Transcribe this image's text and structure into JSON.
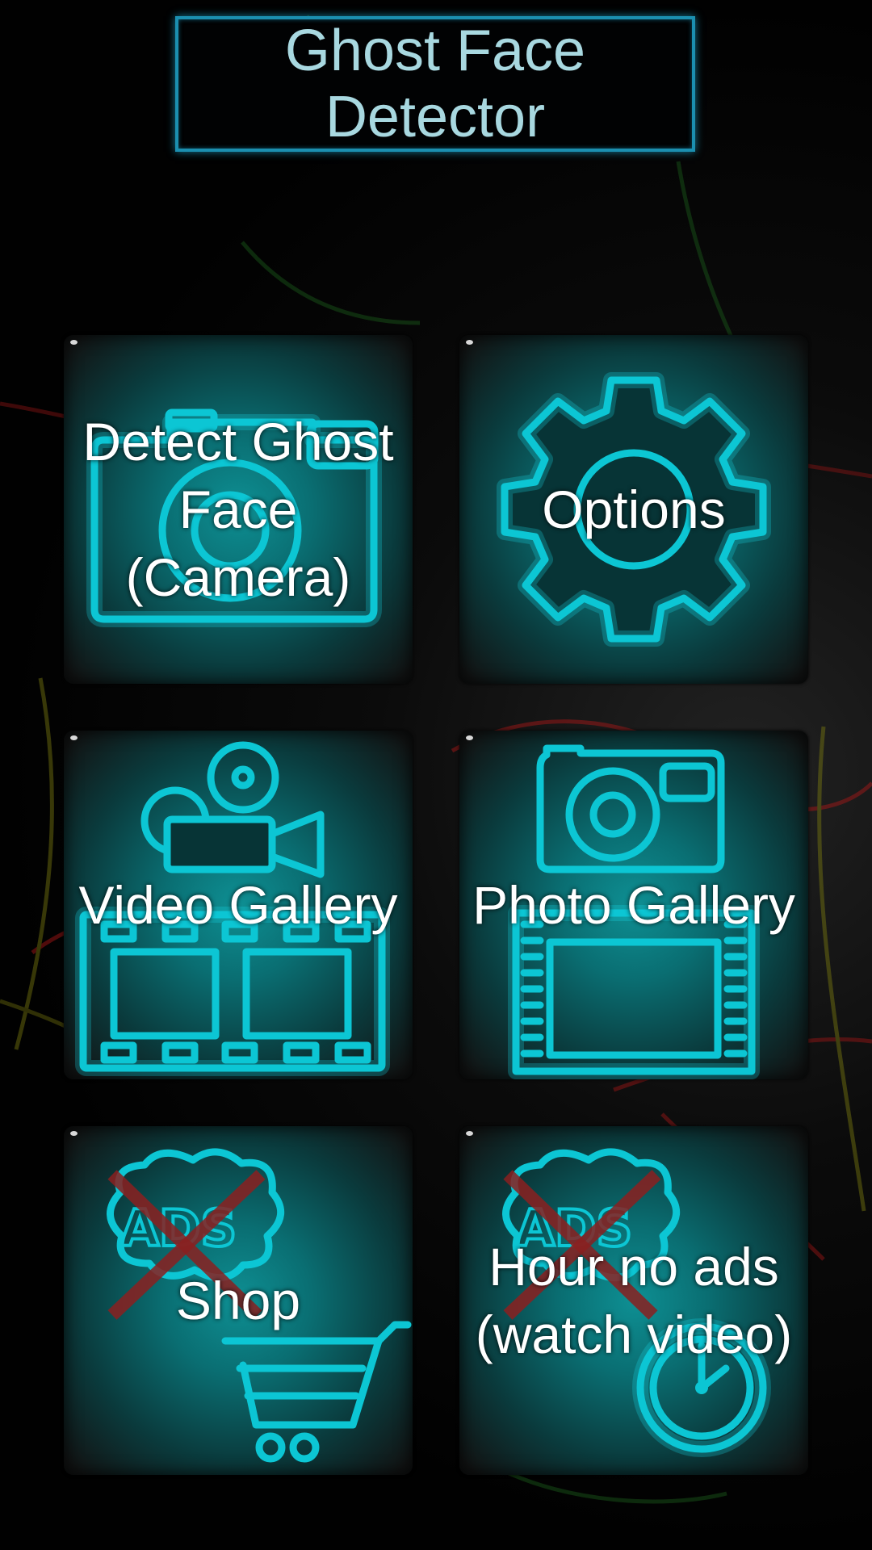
{
  "app": {
    "title": "Ghost Face Detector"
  },
  "menu": {
    "detect_camera": "Detect Ghost Face (Camera)",
    "options": "Options",
    "video_gallery": "Video Gallery",
    "photo_gallery": "Photo Gallery",
    "shop": "Shop",
    "no_ads": "Hour no ads (watch video)"
  },
  "icons": {
    "detect_camera": "camera-icon",
    "options": "gear-icon",
    "video_gallery": "film-camera-icon",
    "photo_gallery": "photo-icon",
    "shop": "no-ads-cart-icon",
    "no_ads": "no-ads-clock-icon"
  },
  "colors": {
    "neon_accent": "#0cc6d4",
    "title_text": "#a8d8e0",
    "title_border": "#1b8fb0",
    "cross_red": "#8a2020"
  }
}
